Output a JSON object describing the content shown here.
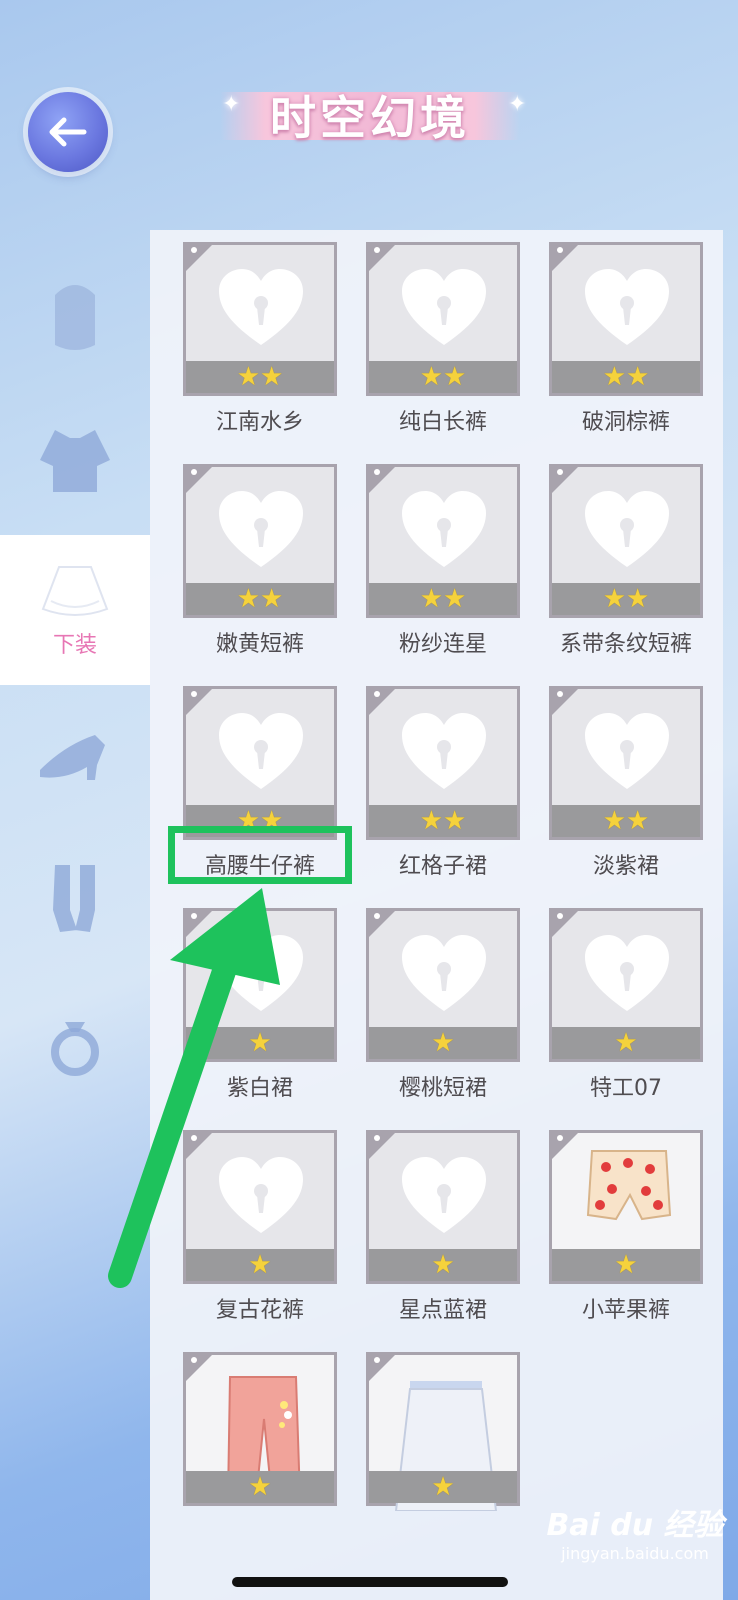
{
  "header": {
    "title": "时空幻境",
    "back_icon": "back-arrow-icon"
  },
  "sidebar": {
    "tabs": [
      {
        "name": "hair",
        "icon": "hair-icon",
        "active": false
      },
      {
        "name": "top",
        "icon": "jacket-icon",
        "active": false
      },
      {
        "name": "bottom",
        "icon": "skirt-icon",
        "active": true,
        "label": "下装"
      },
      {
        "name": "shoes",
        "icon": "heels-icon",
        "active": false
      },
      {
        "name": "socks",
        "icon": "socks-icon",
        "active": false
      },
      {
        "name": "accessory",
        "icon": "ring-icon",
        "active": false
      }
    ]
  },
  "items": [
    {
      "label": "江南水乡",
      "stars": 2,
      "locked": true
    },
    {
      "label": "纯白长裤",
      "stars": 2,
      "locked": true
    },
    {
      "label": "破洞棕裤",
      "stars": 2,
      "locked": true
    },
    {
      "label": "嫩黄短裤",
      "stars": 2,
      "locked": true
    },
    {
      "label": "粉纱连星",
      "stars": 2,
      "locked": true
    },
    {
      "label": "系带条纹短裤",
      "stars": 2,
      "locked": true
    },
    {
      "label": "高腰牛仔裤",
      "stars": 2,
      "locked": true
    },
    {
      "label": "红格子裙",
      "stars": 2,
      "locked": true
    },
    {
      "label": "淡紫裙",
      "stars": 2,
      "locked": true
    },
    {
      "label": "紫白裙",
      "stars": 1,
      "locked": true
    },
    {
      "label": "樱桃短裙",
      "stars": 1,
      "locked": true
    },
    {
      "label": "特工07",
      "stars": 1,
      "locked": true
    },
    {
      "label": "复古花裤",
      "stars": 1,
      "locked": true
    },
    {
      "label": "星点蓝裙",
      "stars": 1,
      "locked": true
    },
    {
      "label": "小苹果裤",
      "stars": 1,
      "locked": false,
      "art": "apple-shorts"
    },
    {
      "label": "",
      "stars": 1,
      "locked": false,
      "art": "pink-pants"
    },
    {
      "label": "",
      "stars": 1,
      "locked": false,
      "art": "white-skirt"
    }
  ],
  "annotation": {
    "highlighted_item": "高腰牛仔裤",
    "color": "#1ec25c"
  },
  "watermark": {
    "logo": "Bai du 经验",
    "url": "jingyan.baidu.com"
  },
  "colors": {
    "accent_pink": "#e776b4",
    "star": "#f5d23c",
    "card_border": "#a8a3ad"
  }
}
